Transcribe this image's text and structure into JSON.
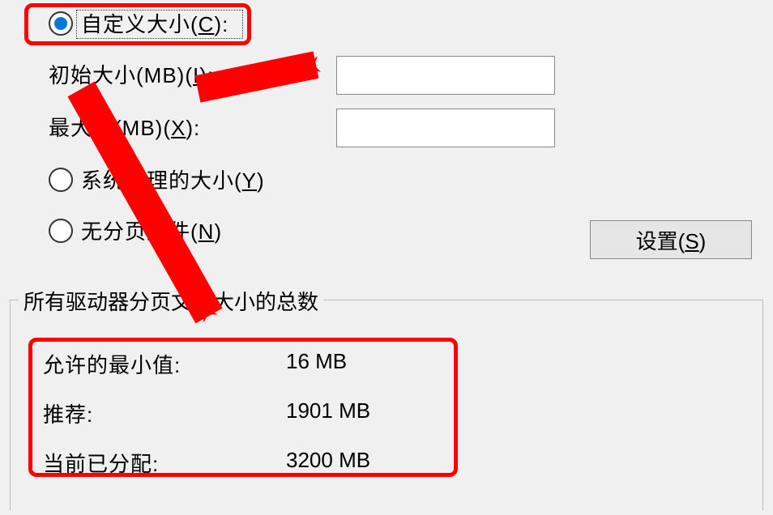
{
  "radios": {
    "custom_size": "自定义大小(C):",
    "system_managed": "系统管理的大小(Y)",
    "no_paging": "无分页文件(N)"
  },
  "labels": {
    "initial_size": "初始大小(MB)(I):",
    "max_value": "最大值(MB)(X):"
  },
  "inputs": {
    "initial_value": "",
    "max_value": ""
  },
  "buttons": {
    "set": "设置(S)"
  },
  "group": {
    "title": "所有驱动器分页文件大小的总数",
    "rows": [
      {
        "label": "允许的最小值:",
        "value": "16 MB"
      },
      {
        "label": "推荐:",
        "value": "1901 MB"
      },
      {
        "label": "当前已分配:",
        "value": "3200 MB"
      }
    ]
  }
}
